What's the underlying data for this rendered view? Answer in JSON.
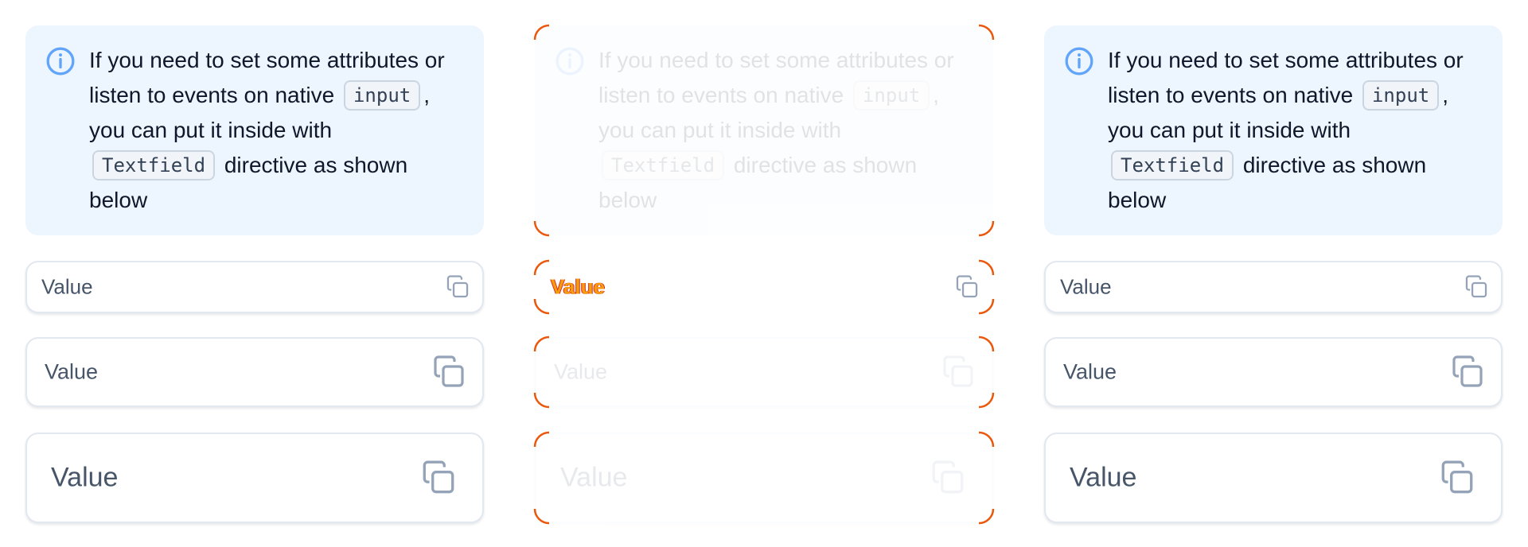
{
  "alert": {
    "icon": "info-circle-icon",
    "text_before_input": "If you need to set some attributes or listen to events on native",
    "code_input": "input",
    "text_after_input": ", you can put it inside with",
    "code_textfield": "Textfield",
    "text_after_textfield": "directive as shown below"
  },
  "fields": {
    "small_value": "Value",
    "medium_value": "Value",
    "large_value": "Value",
    "copy_icon": "copy-icon"
  },
  "colors": {
    "alert_bg": "#edf5fe",
    "alert_icon": "#60a5fa",
    "border": "#e2e8f0",
    "text": "#0f172a",
    "muted": "#475569",
    "highlight": "#ea580c"
  }
}
